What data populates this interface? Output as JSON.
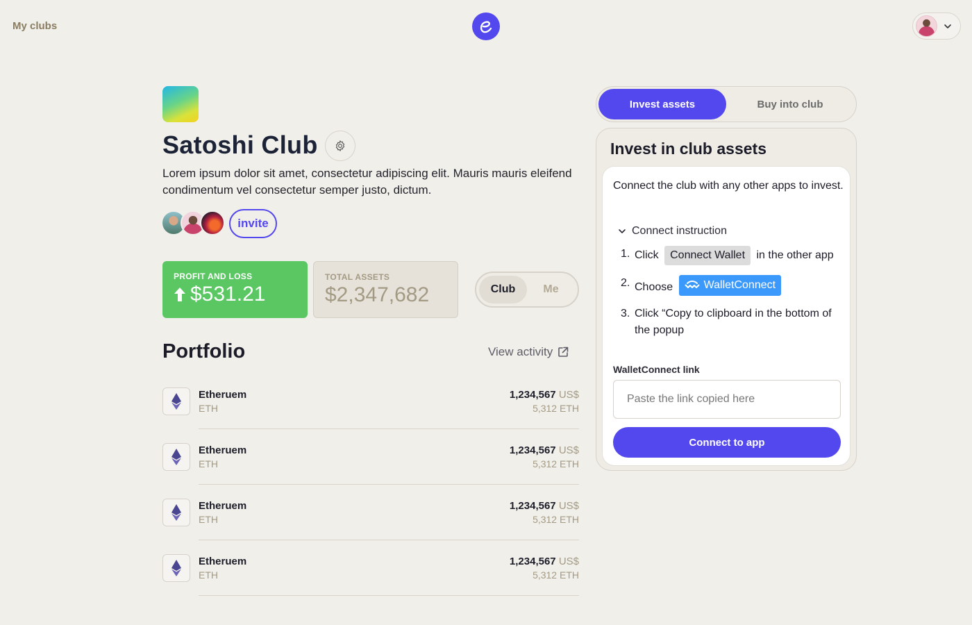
{
  "nav": {
    "my_clubs_label": "My clubs"
  },
  "club": {
    "title": "Satoshi Club",
    "description": "Lorem ipsum dolor sit amet, consectetur adipiscing elit. Mauris mauris eleifend condimentum vel consectetur semper justo, dictum.",
    "invite_label": "invite"
  },
  "stats": {
    "profit_loss": {
      "label": "PROFIT AND LOSS",
      "value": "$531.21",
      "color": "#5ac763"
    },
    "total_assets": {
      "label": "TOTAL ASSETS",
      "value": "$2,347,682"
    }
  },
  "view_toggle": {
    "options": [
      "Club",
      "Me"
    ],
    "selected": "Club"
  },
  "portfolio": {
    "title": "Portfolio",
    "view_activity_label": "View activity",
    "assets": [
      {
        "name": "Etheruem",
        "ticker": "ETH",
        "usd_value": "1,234,567",
        "usd_currency": "US$",
        "amount": "5,312 ETH",
        "icon": "ethereum-icon"
      },
      {
        "name": "Etheruem",
        "ticker": "ETH",
        "usd_value": "1,234,567",
        "usd_currency": "US$",
        "amount": "5,312 ETH",
        "icon": "ethereum-icon"
      },
      {
        "name": "Etheruem",
        "ticker": "ETH",
        "usd_value": "1,234,567",
        "usd_currency": "US$",
        "amount": "5,312 ETH",
        "icon": "ethereum-icon"
      },
      {
        "name": "Etheruem",
        "ticker": "ETH",
        "usd_value": "1,234,567",
        "usd_currency": "US$",
        "amount": "5,312 ETH",
        "icon": "ethereum-icon"
      }
    ]
  },
  "panel": {
    "tabs": [
      {
        "label": "Invest assets",
        "active": true
      },
      {
        "label": "Buy into club",
        "active": false
      }
    ],
    "title": "Invest in club assets",
    "intro": "Connect the club with any other apps to invest.",
    "instruction_toggle_label": "Connect instruction",
    "steps": {
      "s1": {
        "num": "1.",
        "before": "Click",
        "chip": "Connect Wallet",
        "after": "in the other app"
      },
      "s2": {
        "num": "2.",
        "before": "Choose",
        "chip": "WalletConnect"
      },
      "s3": {
        "num": "3.",
        "text": "Click “Copy to clipboard in the bottom of the popup"
      }
    },
    "link_label": "WalletConnect link",
    "link_placeholder": "Paste the link copied here",
    "link_value": "",
    "connect_button_label": "Connect to app"
  },
  "colors": {
    "accent": "#5347ee",
    "background": "#f1efea",
    "profit_green": "#5ac763",
    "walletconnect_blue": "#3b99fc"
  }
}
